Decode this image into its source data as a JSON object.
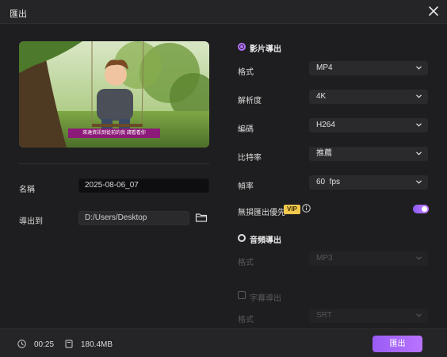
{
  "window": {
    "title": "匯出"
  },
  "left": {
    "subtitle_text": "來達資訊到從前的我 請看看你",
    "name_label": "名稱",
    "name_value": "2025-08-06_07",
    "export_to_label": "導出到",
    "path_value": "D:/Users/Desktop"
  },
  "video_section": {
    "title": "影片導出",
    "rows": [
      {
        "label": "格式",
        "value": "MP4"
      },
      {
        "label": "解析度",
        "value": "4K"
      },
      {
        "label": "編碼",
        "value": "H264"
      },
      {
        "label": "比特率",
        "value": "推薦"
      },
      {
        "label": "幀率",
        "value": "60  fps"
      }
    ],
    "lossless_label": "無損匯出優先",
    "vip_badge": "VIP",
    "lossless_enabled": true
  },
  "audio_section": {
    "title": "音頻導出",
    "format_label": "格式",
    "format_value": "MP3"
  },
  "subtitle_section": {
    "title": "字幕導出",
    "format_label": "格式",
    "format_value": "SRT"
  },
  "footer": {
    "duration": "00:25",
    "size": "180.4MB",
    "export_label": "匯出"
  },
  "colors": {
    "accent": "#b472ff",
    "vip": "#f2c94c",
    "bg": "#1e1e20"
  },
  "icons": [
    "close-icon",
    "folder-icon",
    "chevron-down-icon",
    "info-icon",
    "clock-icon",
    "file-size-icon"
  ]
}
